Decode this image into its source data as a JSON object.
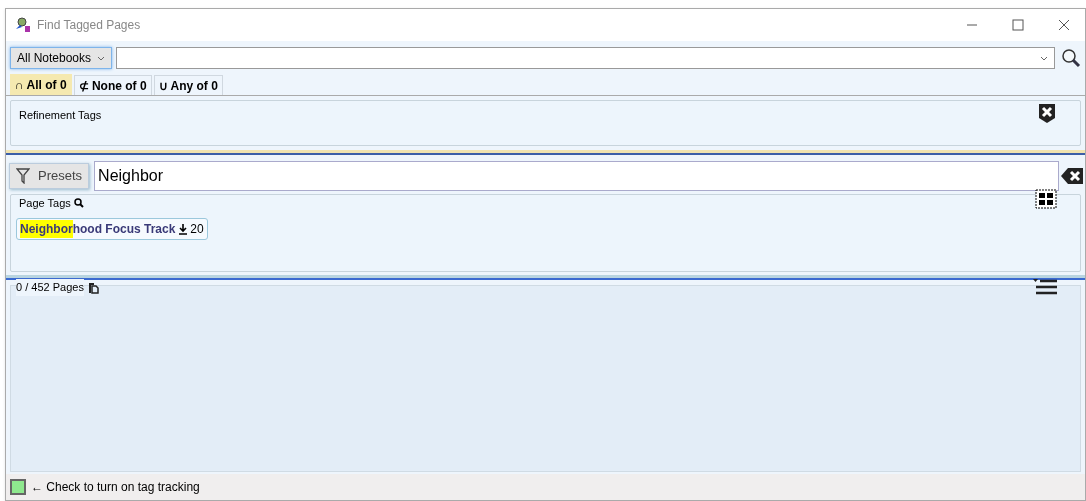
{
  "window": {
    "title": "Find Tagged Pages"
  },
  "scope_dropdown": {
    "label": "All Notebooks"
  },
  "tabs": [
    {
      "label": "∩ All of 0",
      "selected": true
    },
    {
      "label": "⊄ None of 0",
      "selected": false
    },
    {
      "label": "∪ Any of 0",
      "selected": false
    }
  ],
  "refinement_tags": {
    "title": "Refinement Tags"
  },
  "presets_button": {
    "label": "Presets"
  },
  "filter": {
    "value": "Neighbor"
  },
  "page_tags": {
    "title": "Page Tags",
    "tags": [
      {
        "match": "Neighbor",
        "rest": "hood Focus Track",
        "count": "20"
      }
    ]
  },
  "pages": {
    "count": "0 / 452 Pages"
  },
  "status_bar": {
    "checked": false,
    "label": "← Check to turn on tag tracking"
  }
}
